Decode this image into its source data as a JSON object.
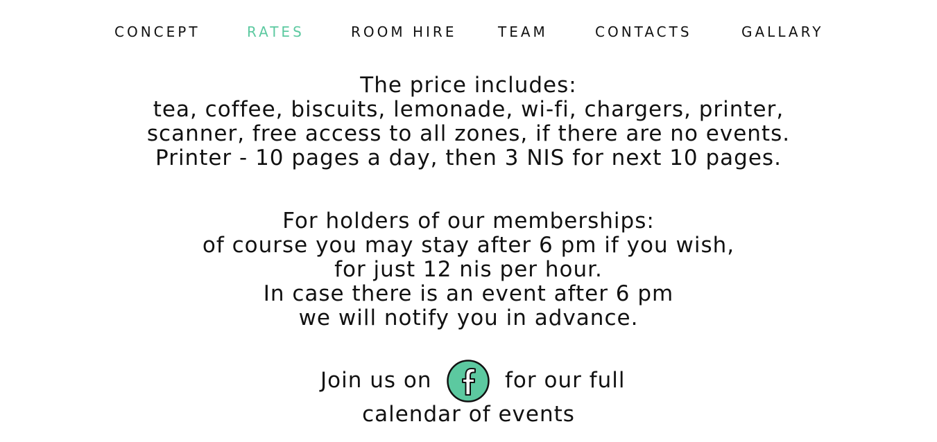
{
  "nav": {
    "items": [
      {
        "id": "concept",
        "label": "CONCEPT",
        "active": false
      },
      {
        "id": "rates",
        "label": "RATES",
        "active": true
      },
      {
        "id": "roomhire",
        "label": "ROOM HIRE",
        "active": false
      },
      {
        "id": "team",
        "label": "TEAM",
        "active": false
      },
      {
        "id": "contacts",
        "label": "CONTACTS",
        "active": false
      },
      {
        "id": "gallary",
        "label": "GALLARY",
        "active": false
      }
    ],
    "active_color": "#5cc9a0"
  },
  "price": {
    "lines": [
      "The price includes:",
      "tea, coffee, biscuits, lemonade, wi-fi, chargers, printer,",
      "scanner, free access to all zones, if there are no events.",
      "Printer - 10 pages a day, then 3 NIS for next 10 pages."
    ]
  },
  "membership": {
    "lines": [
      "For holders of our memberships:",
      "of course you may stay after 6 pm if you wish,",
      "for just 12 nis per hour.",
      "In case there is an event after 6 pm",
      "we will notify you in advance."
    ]
  },
  "join": {
    "before_icon": "Join us on",
    "after_icon": "for our full",
    "second_line": "calendar of events",
    "icon": "facebook-icon",
    "icon_color": "#5cc9a0"
  }
}
